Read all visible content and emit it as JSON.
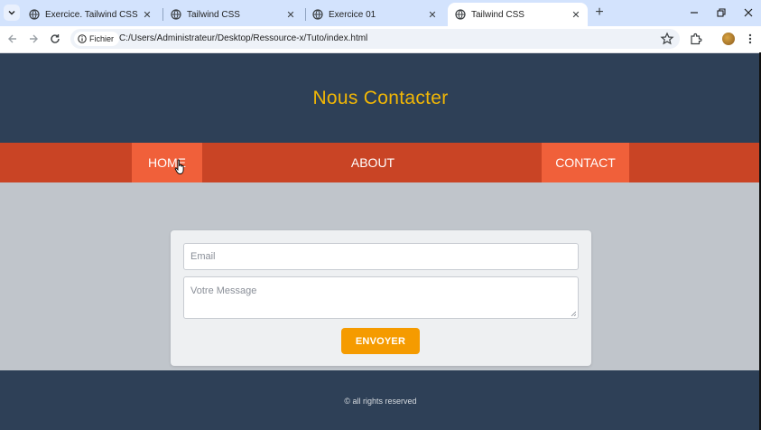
{
  "browser": {
    "tabs": [
      {
        "title": "Exercice. Tailwind CSS",
        "active": false
      },
      {
        "title": "Tailwind CSS",
        "active": false
      },
      {
        "title": "Exercice 01",
        "active": false
      },
      {
        "title": "Tailwind CSS",
        "active": true
      }
    ],
    "address": {
      "chip_label": "Fichier",
      "url": "C:/Users/Administrateur/Desktop/Ressource-x/Tuto/index.html"
    }
  },
  "page": {
    "title": "Nous Contacter",
    "nav": [
      {
        "label": "HOME"
      },
      {
        "label": "ABOUT"
      },
      {
        "label": "CONTACT"
      }
    ],
    "form": {
      "email_placeholder": "Email",
      "message_placeholder": "Votre Message",
      "submit_label": "ENVOYER"
    },
    "footer": "© all rights reserved"
  },
  "colors": {
    "header_bg": "#2e4057",
    "title_color": "#f2b705",
    "nav_bg": "#c94425",
    "nav_highlight": "#f0603a",
    "button_bg": "#f59b00"
  }
}
